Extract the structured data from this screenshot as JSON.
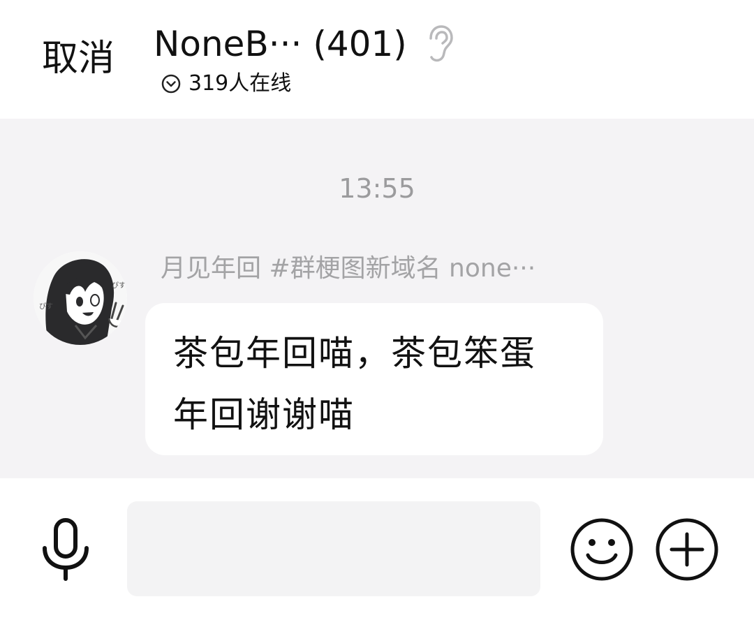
{
  "header": {
    "cancel_label": "取消",
    "group_title": "NoneB··· (401)",
    "ear_icon": "ear-icon",
    "online_chevron_icon": "chevron-down-circle-icon",
    "online_count_text": "319人在线"
  },
  "chat": {
    "timestamp": "13:55",
    "messages": [
      {
        "sender_name": "月见年回 #群梗图新域名 none···",
        "avatar": "avatar-icon",
        "text_lines": [
          "茶包年回喵，茶包笨蛋",
          "年回谢谢喵"
        ]
      }
    ]
  },
  "input_bar": {
    "voice_icon": "microphone-icon",
    "input_value": "",
    "input_placeholder": "",
    "emoji_icon": "smiley-icon",
    "more_icon": "plus-circle-icon"
  },
  "colors": {
    "chat_background": "#f4f3f5",
    "bubble_background": "#ffffff",
    "timestamp_text": "#9b9b9d",
    "sender_text": "#a3a3a5",
    "primary_text": "#111111",
    "input_background": "#f3f3f4"
  }
}
